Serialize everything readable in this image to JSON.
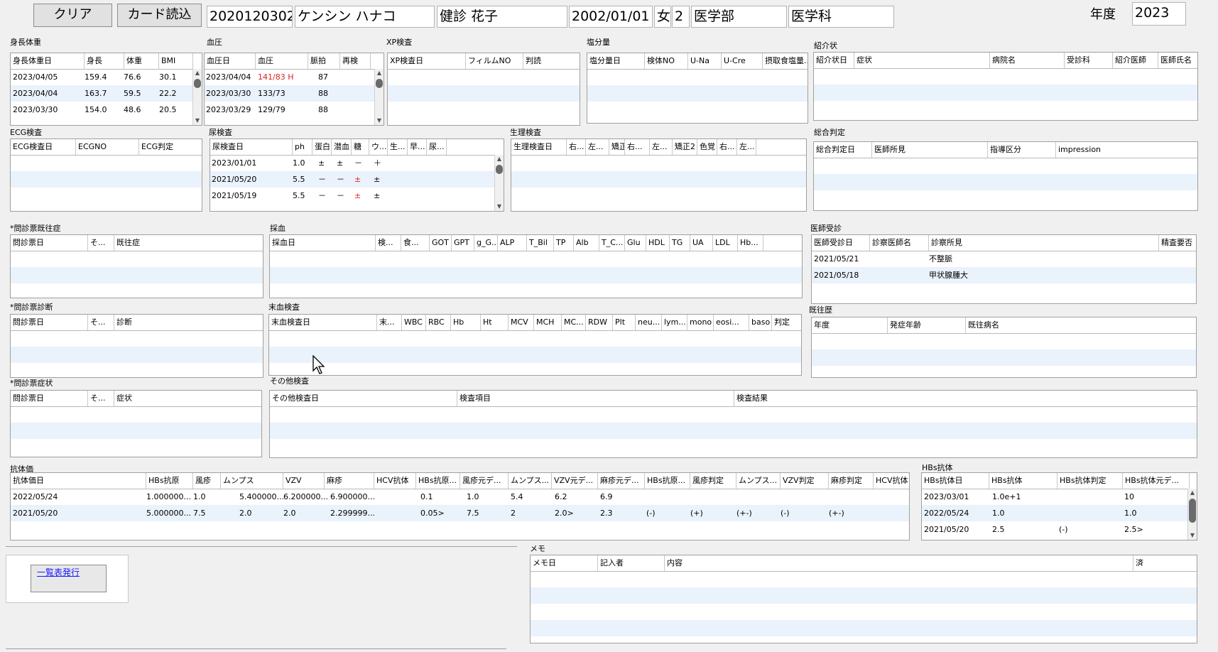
{
  "header": {
    "clear_label": "クリア",
    "card_read_label": "カード読込",
    "id": "2020120302",
    "kana": "ケンシン ハナコ",
    "name": "健診 花子",
    "birth": "2002/01/01",
    "sex": "女",
    "grade": "2",
    "faculty": "医学部",
    "department": "医学科",
    "year_label": "年度",
    "year": "2023"
  },
  "sections": {
    "height_weight": {
      "label": "身長体重",
      "headers": [
        "身長体重日",
        "身長",
        "体重",
        "BMI"
      ],
      "rows": [
        [
          "2023/04/05",
          "159.4",
          "76.6",
          "30.1"
        ],
        [
          "2023/04/04",
          "163.7",
          "59.5",
          "22.2"
        ],
        [
          "2023/03/30",
          "154.0",
          "48.6",
          "20.5"
        ]
      ]
    },
    "blood_pressure": {
      "label": "血圧",
      "headers": [
        "血圧日",
        "血圧",
        "脈拍",
        "再検"
      ],
      "rows": [
        [
          "2023/04/04",
          "141/83 H",
          "87",
          ""
        ],
        [
          "2023/03/30",
          "133/73",
          "88",
          ""
        ],
        [
          "2023/03/29",
          "129/79",
          "88",
          ""
        ]
      ]
    },
    "xp": {
      "label": "XP検査",
      "headers": [
        "XP検査日",
        "フィルムNO",
        "判読"
      ]
    },
    "salt": {
      "label": "塩分量",
      "headers": [
        "塩分量日",
        "検体NO",
        "U-Na",
        "U-Cre",
        "摂取食塩量..."
      ]
    },
    "referral": {
      "label": "紹介状",
      "headers": [
        "紹介状日",
        "症状",
        "病院名",
        "受診科",
        "紹介医師",
        "医師氏名"
      ]
    },
    "ecg": {
      "label": "ECG検査",
      "headers": [
        "ECG検査日",
        "ECGNO",
        "ECG判定"
      ]
    },
    "urine": {
      "label": "尿検査",
      "headers": [
        "尿検査日",
        "ph",
        "蛋白",
        "潜血",
        "糖",
        "ウ...",
        "生...",
        "早...",
        "尿..."
      ],
      "rows": [
        [
          "2023/01/01",
          "1.0",
          "±",
          "±",
          "－",
          "＋"
        ],
        [
          "2021/05/20",
          "5.5",
          "－",
          "－",
          "±",
          "±"
        ],
        [
          "2021/05/19",
          "5.5",
          "－",
          "－",
          "±",
          "±"
        ]
      ]
    },
    "physio": {
      "label": "生理検査",
      "headers": [
        "生理検査日",
        "右...",
        "左...",
        "矯正1",
        "右...",
        "左...",
        "矯正2",
        "色覚",
        "右...",
        "左..."
      ]
    },
    "overall": {
      "label": "総合判定",
      "headers": [
        "総合判定日",
        "医師所見",
        "指導区分",
        "impression"
      ]
    },
    "monshin_history": {
      "label": "*問診票既往症",
      "headers": [
        "問診票日",
        "そ...",
        "既往症"
      ]
    },
    "blood_draw": {
      "label": "採血",
      "headers": [
        "採血日",
        "検...",
        "食...",
        "GOT",
        "GPT",
        "g_G...",
        "ALP",
        "T_Bil",
        "TP",
        "Alb",
        "T_C...",
        "Glu",
        "HDL",
        "TG",
        "UA",
        "LDL",
        "Hb..."
      ]
    },
    "doctor_visit": {
      "label": "医師受診",
      "headers": [
        "医師受診日",
        "診察医師名",
        "診察所見",
        "精査要否"
      ],
      "rows": [
        [
          "2021/05/21",
          "",
          "不整脈"
        ],
        [
          "2021/05/18",
          "",
          "甲状腺腫大"
        ]
      ]
    },
    "monshin_diag": {
      "label": "*問診票診断",
      "headers": [
        "問診票日",
        "そ...",
        "診断"
      ]
    },
    "peripheral_blood": {
      "label": "末血検査",
      "headers": [
        "末血検査日",
        "末...",
        "WBC",
        "RBC",
        "Hb",
        "Ht",
        "MCV",
        "MCH",
        "MC...",
        "RDW",
        "Plt",
        "neu...",
        "lym...",
        "mono",
        "eosi...",
        "baso",
        "判定"
      ]
    },
    "past_history": {
      "label": "既往歴",
      "headers": [
        "年度",
        "発症年齢",
        "既往病名"
      ]
    },
    "monshin_symptom": {
      "label": "*問診票症状",
      "headers": [
        "問診票日",
        "そ...",
        "症状"
      ]
    },
    "other_tests": {
      "label": "その他検査",
      "headers": [
        "その他検査日",
        "検査項目",
        "検査結果"
      ]
    },
    "antibody": {
      "label": "抗体価",
      "headers": [
        "抗体価日",
        "HBs抗原",
        "風疹",
        "ムンプス",
        "VZV",
        "麻疹",
        "HCV抗体",
        "HBs抗原...",
        "風疹元デ...",
        "ムンプス...",
        "VZV元デ...",
        "麻疹元デ...",
        "HBs抗原...",
        "風疹判定",
        "ムンプス...",
        "VZV判定",
        "麻疹判定",
        "HCV抗体"
      ],
      "rows": [
        [
          "2022/05/24",
          "1.000000...",
          "1.0",
          "5.400000...",
          "6.200000...",
          "6.900000...",
          "",
          "0.1",
          "1.0",
          "5.4",
          "6.2",
          "6.9",
          "",
          "",
          "",
          "",
          "",
          ""
        ],
        [
          "2021/05/20",
          "5.000000...",
          "7.5",
          "2.0",
          "2.0",
          "2.299999...",
          "",
          "0.05>",
          "7.5",
          "2",
          "2.0>",
          "2.3",
          "(-)",
          "(+)",
          "(+-)",
          "(-)",
          "(+-)",
          ""
        ]
      ]
    },
    "hbs_antibody": {
      "label": "HBs抗体",
      "headers": [
        "HBs抗体日",
        "HBs抗体",
        "HBs抗体判定",
        "HBs抗体元デ..."
      ],
      "rows": [
        [
          "2023/03/01",
          "1.0e+1",
          "",
          "10"
        ],
        [
          "2022/05/24",
          "1.0",
          "",
          "1.0"
        ],
        [
          "2021/05/20",
          "2.5",
          "(-)",
          "2.5>"
        ]
      ]
    },
    "memo": {
      "label": "メモ",
      "headers": [
        "メモ日",
        "記入者",
        "内容",
        "済"
      ]
    },
    "list_issue_label": "一覧表発行"
  }
}
